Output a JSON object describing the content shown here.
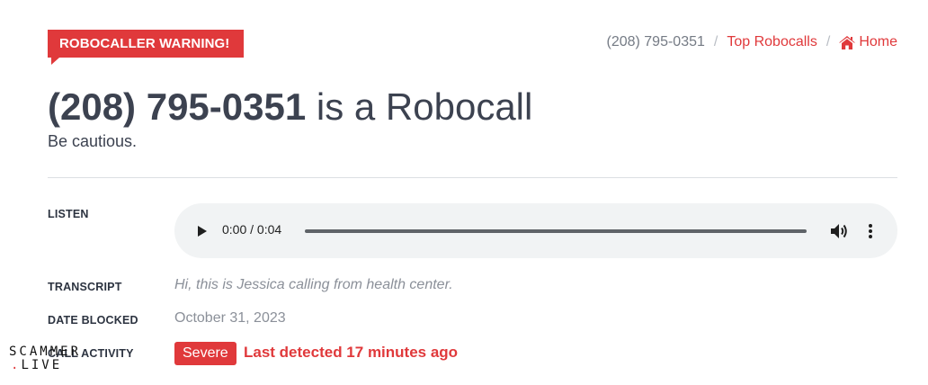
{
  "banner": {
    "label": "ROBOCALLER WARNING!"
  },
  "breadcrumb": {
    "current": "(208) 795-0351",
    "sep": "/",
    "top_label": "Top Robocalls",
    "home_label": "Home"
  },
  "header": {
    "number": "(208) 795-0351",
    "suffix": " is a Robocall",
    "subtitle": "Be cautious."
  },
  "details": {
    "listen_label": "LISTEN",
    "transcript_label": "TRANSCRIPT",
    "date_label": "DATE BLOCKED",
    "activity_label": "CALL ACTIVITY",
    "transcript": "Hi, this is Jessica calling from health center.",
    "date": "October 31, 2023",
    "severity": "Severe",
    "last_detected": "Last detected 17 minutes ago"
  },
  "player": {
    "time": "0:00 / 0:04",
    "progress": 0
  },
  "watermark": {
    "line1": "SCAMMER",
    "line2_dot": ".",
    "line2": "LIVE"
  },
  "colors": {
    "accent": "#e0393b",
    "text": "#3c4250",
    "muted": "#8b9099"
  }
}
